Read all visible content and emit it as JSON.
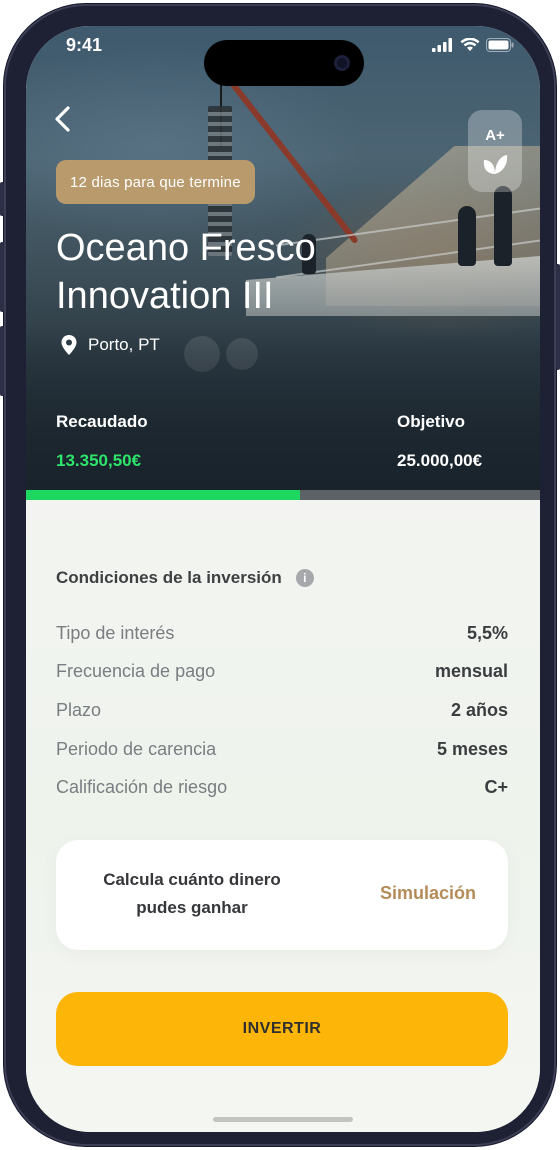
{
  "status_bar": {
    "time": "9:41"
  },
  "header": {
    "days_badge": "12 dias para que termine",
    "title": "Oceano Fresco Innovation III",
    "location": "Porto, PT",
    "rating": "A+"
  },
  "funding": {
    "raised_label": "Recaudado",
    "raised_value": "13.350,50€",
    "goal_label": "Objetivo",
    "goal_value": "25.000,00€",
    "progress_fraction": 0.534
  },
  "conditions": {
    "title": "Condiciones de la inversión",
    "rows": [
      {
        "label": "Tipo de interés",
        "value": "5,5%"
      },
      {
        "label": "Frecuencia de pago",
        "value": "mensual"
      },
      {
        "label": "Plazo",
        "value": "2 años"
      },
      {
        "label": "Periodo de carencia",
        "value": "5 meses"
      },
      {
        "label": "Calificación de riesgo",
        "value": "C+"
      }
    ]
  },
  "simulator": {
    "text": "Calcula cuánto dinero pudes ganhar",
    "link": "Simulación"
  },
  "cta": {
    "invest_label": "INVERTIR"
  },
  "colors": {
    "accent_gold": "#b89a6c",
    "raised_green": "#2ee46a",
    "progress_green": "#1ed760",
    "cta_yellow": "#fdb608"
  }
}
